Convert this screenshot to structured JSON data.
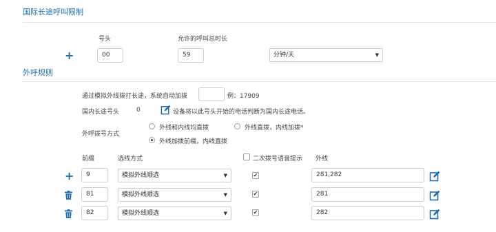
{
  "section1": {
    "title": "国际长途呼叫限制",
    "col_prefix": "号头",
    "col_duration": "允许的呼叫总时长",
    "prefix_value": "00",
    "duration_value": "59",
    "unit_selected": "分钟/天"
  },
  "section2": {
    "title": "外呼规则",
    "auto_prefix_text": "通过模拟外线拨打长途，系统自动加拨",
    "auto_prefix_value": "",
    "auto_prefix_example": "例：17909",
    "domestic_prefix_label": "国内长途号头",
    "domestic_prefix_value": "0",
    "domestic_prefix_desc": "设备将以此号头开始的电话判断为国内长途电话。",
    "dial_mode_label": "外呼拨号方式",
    "dial_mode_options": [
      "外线和内线均直拨",
      "外线直拨，内线加拨*",
      "外线加拨前缀，内线直拨"
    ],
    "dial_mode_selected": 2,
    "col_prefix": "前缀",
    "col_line_mode": "选线方式",
    "col_second_dial": "二次拨号语音提示",
    "col_trunk": "外线",
    "rules": [
      {
        "prefix": "9",
        "line_mode": "模拟外线顺选",
        "second_dial": true,
        "trunk": "281,282",
        "action": "add"
      },
      {
        "prefix": "81",
        "line_mode": "模拟外线顺选",
        "second_dial": true,
        "trunk": "281",
        "action": "delete"
      },
      {
        "prefix": "82",
        "line_mode": "模拟外线顺选",
        "second_dial": true,
        "trunk": "282",
        "action": "delete"
      }
    ]
  },
  "colors": {
    "accent": "#1b6fb3",
    "border": "#c8cdd2",
    "divider": "#e2e6ea"
  },
  "icons": {
    "add": "plus-icon",
    "delete": "trash-icon",
    "edit": "edit-icon",
    "dropdown": "chevron-down-icon"
  }
}
